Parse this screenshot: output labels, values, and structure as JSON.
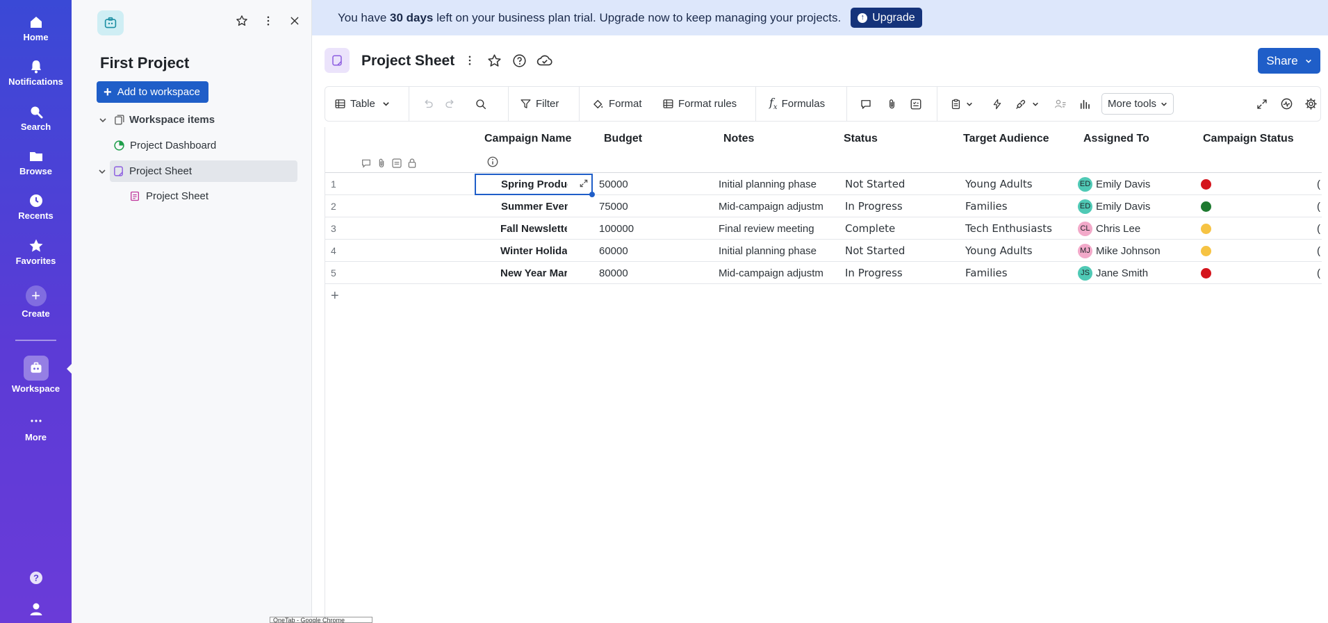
{
  "nav": {
    "items": [
      {
        "label": "Home",
        "icon": "home-icon"
      },
      {
        "label": "Notifications",
        "icon": "bell-icon"
      },
      {
        "label": "Search",
        "icon": "search-icon"
      },
      {
        "label": "Browse",
        "icon": "folder-icon"
      },
      {
        "label": "Recents",
        "icon": "clock-icon"
      },
      {
        "label": "Favorites",
        "icon": "star-icon"
      },
      {
        "label": "Create",
        "icon": "plus-icon"
      },
      {
        "label": "Workspace",
        "icon": "workspace-icon"
      },
      {
        "label": "More",
        "icon": "more-icon"
      }
    ]
  },
  "panel": {
    "title": "First Project",
    "add_label": "Add to workspace",
    "tree": {
      "workspace_items": "Workspace items",
      "dashboard": "Project Dashboard",
      "sheet": "Project Sheet",
      "sheet_child": "Project Sheet"
    }
  },
  "banner": {
    "prefix": "You have ",
    "days": "30 days",
    "suffix": " left on your business plan trial. Upgrade now to keep managing your projects.",
    "upgrade_label": "Upgrade"
  },
  "sheet": {
    "title": "Project Sheet",
    "share_label": "Share"
  },
  "toolbar": {
    "view": "Table",
    "filter": "Filter",
    "format": "Format",
    "format_rules": "Format rules",
    "formulas": "Formulas",
    "more_tools": "More tools"
  },
  "grid": {
    "columns": [
      "Campaign Name",
      "Budget",
      "Notes",
      "Status",
      "Target Audience",
      "Assigned To",
      "Campaign Status"
    ],
    "rows": [
      {
        "num": "1",
        "name": "Spring Produc",
        "budget": "50000",
        "notes": "Initial planning phase",
        "status": "Not Started",
        "audience": "Young Adults",
        "initials": "ED",
        "assignee": "Emily Davis",
        "avatar_color": "#4fc9b5",
        "camp_color": "#d4141c",
        "edge": "("
      },
      {
        "num": "2",
        "name": "Summer Event P",
        "budget": "75000",
        "notes": "Mid-campaign adjustm",
        "status": "In Progress",
        "audience": "Families",
        "initials": "ED",
        "assignee": "Emily Davis",
        "avatar_color": "#4fc9b5",
        "camp_color": "#1e7a30",
        "edge": "("
      },
      {
        "num": "3",
        "name": "Fall Newsletter C",
        "budget": "100000",
        "notes": "Final review meeting",
        "status": "Complete",
        "audience": "Tech Enthusiasts",
        "initials": "CL",
        "assignee": "Chris Lee",
        "avatar_color": "#f2a9c9",
        "camp_color": "#f6c343",
        "edge": "("
      },
      {
        "num": "4",
        "name": "Winter Holiday S",
        "budget": "60000",
        "notes": "Initial planning phase",
        "status": "Not Started",
        "audience": "Young Adults",
        "initials": "MJ",
        "assignee": "Mike Johnson",
        "avatar_color": "#f2a9c9",
        "camp_color": "#f6c343",
        "edge": "("
      },
      {
        "num": "5",
        "name": "New Year Market",
        "budget": "80000",
        "notes": "Mid-campaign adjustm",
        "status": "In Progress",
        "audience": "Families",
        "initials": "JS",
        "assignee": "Jane Smith",
        "avatar_color": "#4fc9b5",
        "camp_color": "#d4141c",
        "edge": "("
      }
    ]
  },
  "taskbar_tip": "OneTab - Google Chrome"
}
